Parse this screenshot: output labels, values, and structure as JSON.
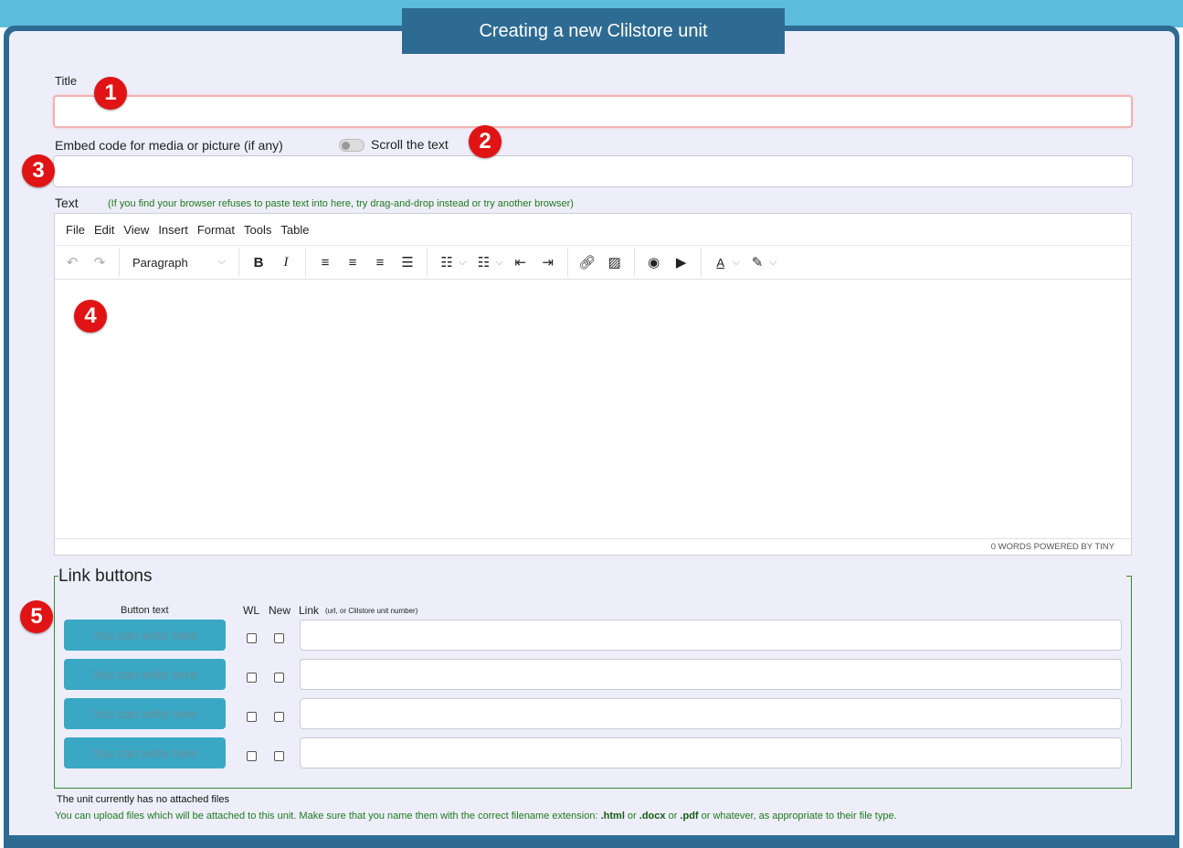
{
  "header": {
    "title": "Creating a new Clilstore unit"
  },
  "form": {
    "title_label": "Title",
    "embed_label": "Embed code for media or picture (if any)",
    "scroll_label": "Scroll the text",
    "text_label": "Text",
    "text_hint": "(If you find your browser refuses to paste text into here, try drag-and-drop instead or try another browser)"
  },
  "editor": {
    "menu": [
      "File",
      "Edit",
      "View",
      "Insert",
      "Format",
      "Tools",
      "Table"
    ],
    "block_format": "Paragraph",
    "status": "0 WORDS  POWERED BY TINY"
  },
  "link_buttons": {
    "legend": "Link buttons",
    "col_button_text": "Button text",
    "col_wl": "WL",
    "col_new": "New",
    "col_link": "Link",
    "col_link_hint": "(url, or Clilstore unit number)",
    "placeholder": "You can write here",
    "rows": [
      {
        "button_text": "You can write here",
        "wl": false,
        "new": false,
        "link": ""
      },
      {
        "button_text": "You can write here",
        "wl": false,
        "new": false,
        "link": ""
      },
      {
        "button_text": "You can write here",
        "wl": false,
        "new": false,
        "link": ""
      },
      {
        "button_text": "You can write here",
        "wl": false,
        "new": false,
        "link": ""
      }
    ]
  },
  "files": {
    "none_attached": "The unit currently has no attached files",
    "upload_prefix": "You can upload files which will be attached to this unit. Make sure that you name them with the correct filename extension: ",
    "ext_html": ".html",
    "or1": " or ",
    "ext_docx": ".docx",
    "or2": " or ",
    "ext_pdf": ".pdf",
    "upload_suffix": " or whatever, as appropriate to their file type."
  },
  "markers": [
    "1",
    "2",
    "3",
    "4",
    "5"
  ],
  "colors": {
    "accent": "#2e6b93",
    "top_band": "#5bbcdc",
    "button": "#3aa8c4",
    "marker": "#e01414",
    "hint_green": "#1e7a1e"
  }
}
